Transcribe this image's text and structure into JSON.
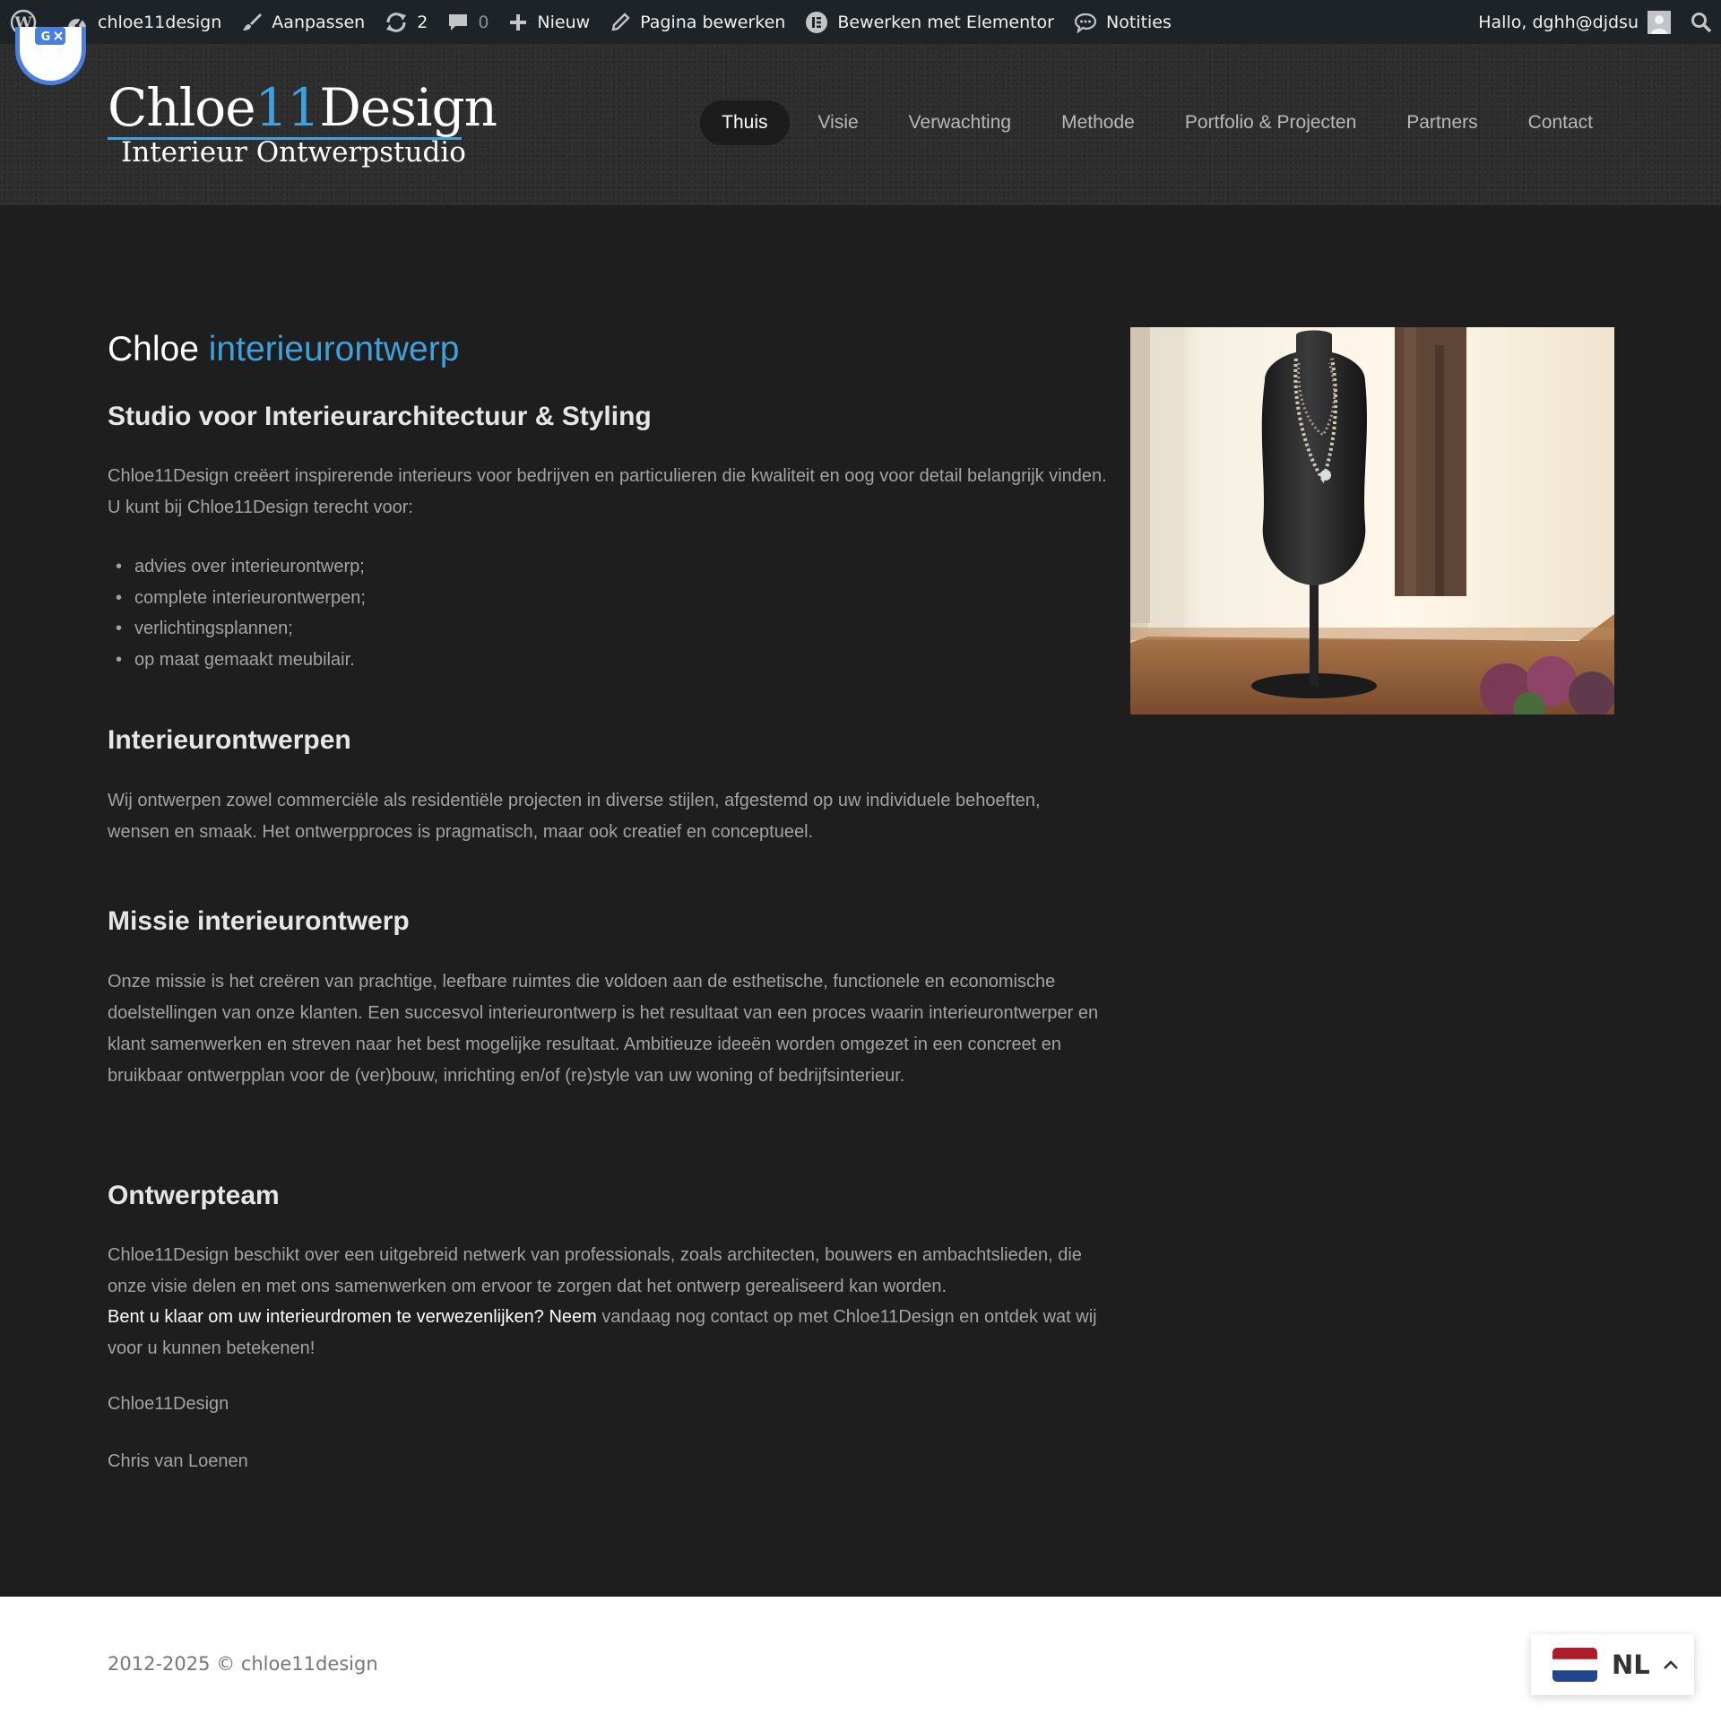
{
  "admin_bar": {
    "site_name": "chloe11design",
    "customize": "Aanpassen",
    "updates_count": "2",
    "comments_count": "0",
    "new": "Nieuw",
    "edit_page": "Pagina bewerken",
    "edit_elementor": "Bewerken met Elementor",
    "notes": "Notities",
    "greeting": "Hallo, dghh@djdsu"
  },
  "logo": {
    "name_left": "Chloe",
    "name_number": "11",
    "name_right": "Design",
    "tagline": "Interieur Ontwerpstudio"
  },
  "nav": {
    "items": [
      {
        "label": "Thuis",
        "active": true
      },
      {
        "label": "Visie"
      },
      {
        "label": "Verwachting"
      },
      {
        "label": "Methode"
      },
      {
        "label": "Portfolio & Projecten"
      },
      {
        "label": "Partners"
      },
      {
        "label": "Contact"
      }
    ]
  },
  "content": {
    "title_plain": "Chloe",
    "title_accent": "interieurontwerp",
    "subtitle": "Studio voor Interieurarchitectuur & Styling",
    "intro": "Chloe11Design creëert inspirerende interieurs voor bedrijven en particulieren die kwaliteit en oog voor detail belangrijk vinden. U kunt bij Chloe11Design terecht voor:",
    "services": [
      "advies over interieurontwerp;",
      "complete interieurontwerpen;",
      "verlichtingsplannen;",
      "op maat gemaakt meubilair."
    ],
    "section1_heading": "Interieurontwerpen",
    "section1_text": "Wij ontwerpen zowel commerciële als residentiële projecten in diverse stijlen, afgestemd op uw individuele behoeften, wensen en smaak. Het ontwerpproces is pragmatisch, maar ook creatief en conceptueel.",
    "section2_heading": "Missie interieurontwerp",
    "section2_text": "Onze missie is het creëren van prachtige, leefbare ruimtes die voldoen aan de esthetische, functionele en economische doelstellingen van onze klanten. Een succesvol interieurontwerp is het resultaat van een proces waarin interieurontwerper en klant samenwerken en streven naar het best mogelijke resultaat. Ambitieuze ideeën worden omgezet in een concreet en bruikbaar ontwerpplan voor de (ver)bouw, inrichting en/of (re)style van uw woning of bedrijfsinterieur.",
    "section3_heading": "Ontwerpteam",
    "section3_text": "Chloe11Design beschikt over een uitgebreid netwerk van professionals, zoals architecten, bouwers en ambachtslieden, die onze visie delen en met ons samenwerken om ervoor te zorgen dat het ontwerp gerealiseerd kan worden.",
    "cta_strong": "Bent u klaar om uw interieurdromen te verwezenlijken? Neem",
    "cta_rest": " vandaag nog contact op met Chloe11Design en ontdek wat wij voor u kunnen betekenen!",
    "signature_company": "Chloe11Design",
    "signature_name": "Chris van Loenen"
  },
  "footer": {
    "copyright": "2012-2025 © chloe11design"
  },
  "language_switcher": {
    "code": "NL"
  },
  "colors": {
    "accent": "#3ea0dc",
    "admin_bar": "#1d2327",
    "page_bg": "#1e1e1e"
  }
}
